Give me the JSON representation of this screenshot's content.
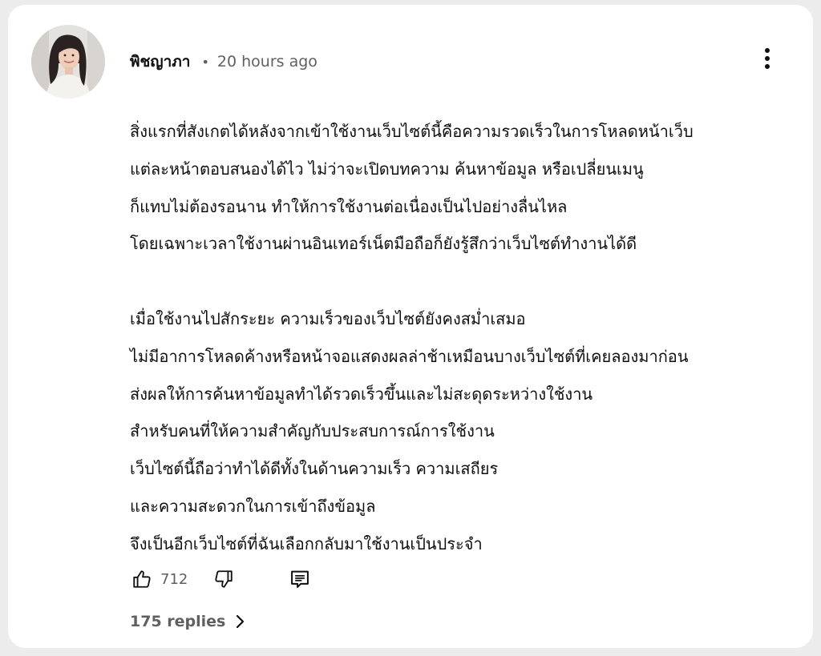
{
  "comment": {
    "author": "พิชญาภา",
    "separator": "•",
    "timestamp": "20 hours ago",
    "paragraphs": [
      [
        "สิ่งแรกที่สังเกตได้หลังจากเข้าใช้งานเว็บไซต์นี้คือความรวดเร็วในการโหลดหน้าเว็บ",
        "แต่ละหน้าตอบสนองได้ไว ไม่ว่าจะเปิดบทความ ค้นหาข้อมูล หรือเปลี่ยนเมนู",
        "ก็แทบไม่ต้องรอนาน ทำให้การใช้งานต่อเนื่องเป็นไปอย่างลื่นไหล",
        "โดยเฉพาะเวลาใช้งานผ่านอินเทอร์เน็ตมือถือก็ยังรู้สึกว่าเว็บไซต์ทำงานได้ดี"
      ],
      [
        "เมื่อใช้งานไปสักระยะ ความเร็วของเว็บไซต์ยังคงสม่ำเสมอ",
        "ไม่มีอาการโหลดค้างหรือหน้าจอแสดงผลล่าช้าเหมือนบางเว็บไซต์ที่เคยลองมาก่อน",
        "ส่งผลให้การค้นหาข้อมูลทำได้รวดเร็วขึ้นและไม่สะดุดระหว่างใช้งาน",
        "สำหรับคนที่ให้ความสำคัญกับประสบการณ์การใช้งาน",
        "เว็บไซต์นี้ถือว่าทำได้ดีทั้งในด้านความเร็ว ความเสถียร",
        "และความสะดวกในการเข้าถึงข้อมูล",
        "จึงเป็นอีกเว็บไซต์ที่ฉันเลือกกลับมาใช้งานเป็นประจำ"
      ]
    ],
    "likes": "712",
    "replies_label": "175 replies"
  },
  "icons": {
    "avatar": "avatar-photo",
    "more": "more-vert-icon",
    "like": "thumbs-up-icon",
    "dislike": "thumbs-down-icon",
    "reply": "reply-comment-icon",
    "chevron": "chevron-right-icon"
  },
  "colors": {
    "card_background": "#ffffff",
    "page_background": "#ececec",
    "primary_text": "#0f0f0f",
    "secondary_text": "#606060"
  }
}
